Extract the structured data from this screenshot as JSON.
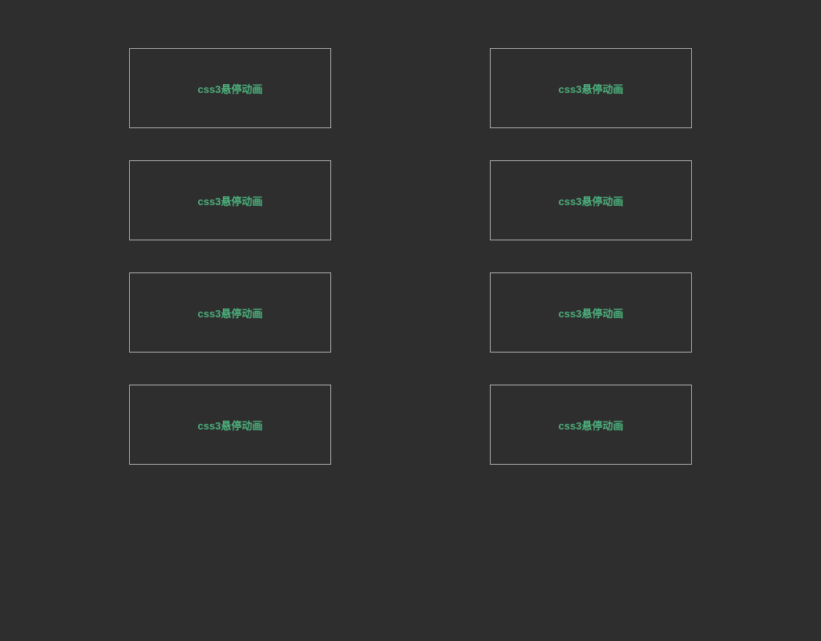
{
  "boxes": [
    {
      "label": "css3悬停动画"
    },
    {
      "label": "css3悬停动画"
    },
    {
      "label": "css3悬停动画"
    },
    {
      "label": "css3悬停动画"
    },
    {
      "label": "css3悬停动画"
    },
    {
      "label": "css3悬停动画"
    },
    {
      "label": "css3悬停动画"
    },
    {
      "label": "css3悬停动画"
    }
  ]
}
